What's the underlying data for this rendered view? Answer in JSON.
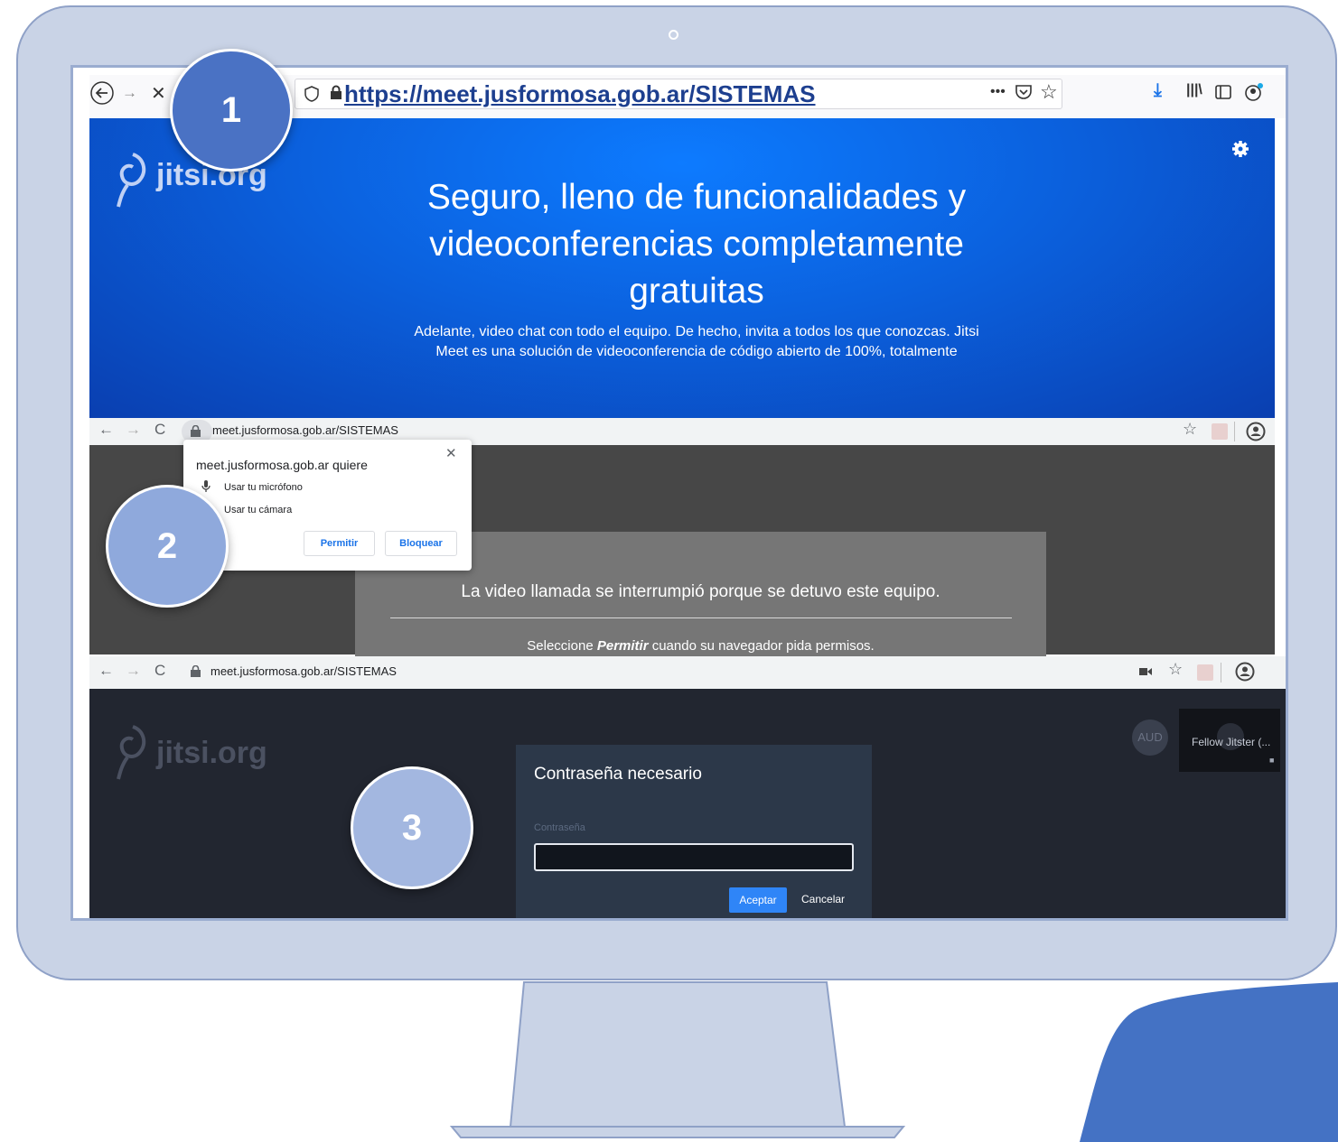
{
  "steps": {
    "one": "1",
    "two": "2",
    "three": "3"
  },
  "panel1": {
    "url": "https://meet.jusformosa.gob.ar/SISTEMAS",
    "logo": "jitsi.org",
    "hero_title_line1": "Seguro, lleno de funcionalidades y",
    "hero_title_line2": "videoconferencias completamente",
    "hero_title_line3": "gratuitas",
    "hero_text_line1": "Adelante, video chat con todo el equipo. De hecho, invita a todos los que conozcas. Jitsi",
    "hero_text_line2": "Meet es una solución de videoconferencia de código abierto de 100%, totalmente"
  },
  "panel2": {
    "url": "meet.jusformosa.gob.ar/SISTEMAS",
    "popup_title": "meet.jusformosa.gob.ar quiere",
    "mic": "Usar tu micrófono",
    "cam": "Usar tu cámara",
    "allow": "Permitir",
    "block": "Bloquear",
    "card_title": "La video llamada se interrumpió porque se detuvo este equipo.",
    "card_sub_pre": "Seleccione ",
    "card_sub_em": "Permitir",
    "card_sub_post": " cuando su navegador pida permisos."
  },
  "panel3": {
    "url": "meet.jusformosa.gob.ar/SISTEMAS",
    "logo": "jitsi.org",
    "dialog_title": "Contraseña necesario",
    "password_label": "Contraseña",
    "accept": "Aceptar",
    "cancel": "Cancelar",
    "avatar": "AUD",
    "participant": "Fellow Jitster (..."
  },
  "colors": {
    "accent": "#2f85f7",
    "step_dark": "#4a72c4",
    "step_light": "#8fa9dc"
  }
}
